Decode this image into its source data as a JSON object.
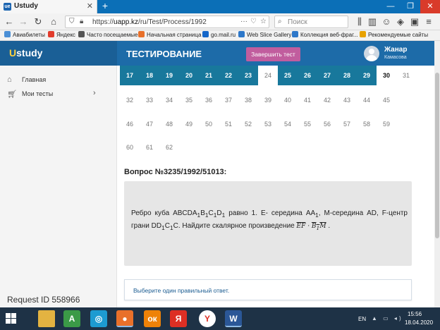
{
  "browser": {
    "tab_title": "Ustudy",
    "tab_favicon": "ue",
    "new_tab": "+",
    "url_prefix": "https://",
    "url_host": "uapp.kz",
    "url_path": "/ru/Test/Process/1992",
    "search_placeholder": "Поиск"
  },
  "bookmarks": [
    {
      "label": "Авиабилеты",
      "icon": "globe-icon",
      "color": "#4a8fd6"
    },
    {
      "label": "Яндекс",
      "icon": "yandex-icon",
      "color": "#e23c2c"
    },
    {
      "label": "Часто посещаемые",
      "icon": "gear-icon",
      "color": "#555555"
    },
    {
      "label": "Начальная страница",
      "icon": "firefox-icon",
      "color": "#e8702a"
    },
    {
      "label": "go.mail.ru",
      "icon": "mail-icon",
      "color": "#1466c9"
    },
    {
      "label": "Web Slice Gallery",
      "icon": "ie-icon",
      "color": "#2d77c9"
    },
    {
      "label": "Коллекция веб-фраг...",
      "icon": "ie-icon",
      "color": "#2d77c9"
    },
    {
      "label": "Рекомендуемые сайты",
      "icon": "ie-icon",
      "color": "#e8a200"
    }
  ],
  "header": {
    "brand_first": "U",
    "brand_rest": "study",
    "title": "ТЕСТИРОВАНИЕ",
    "finish_button": "Завершить тест",
    "user_name": "Жанар",
    "user_surname": "Камасова"
  },
  "sidebar": {
    "items": [
      {
        "label": "Главная",
        "icon": "home-icon"
      },
      {
        "label": "Мои тесты",
        "icon": "cart-icon",
        "chevron": "›"
      }
    ],
    "request_id": "Request ID 558966"
  },
  "question_grid": {
    "rows": [
      [
        "17",
        "18",
        "19",
        "20",
        "21",
        "22",
        "23",
        "24",
        "25",
        "26",
        "27",
        "28",
        "29",
        "30",
        "31"
      ],
      [
        "32",
        "33",
        "34",
        "35",
        "36",
        "37",
        "38",
        "39",
        "40",
        "41",
        "42",
        "43",
        "44",
        "45"
      ],
      [
        "46",
        "47",
        "48",
        "49",
        "50",
        "51",
        "52",
        "53",
        "54",
        "55",
        "56",
        "57",
        "58",
        "59"
      ],
      [
        "60",
        "61",
        "62"
      ]
    ],
    "answered": [
      "17",
      "18",
      "19",
      "20",
      "21",
      "22",
      "23",
      "25",
      "26",
      "27",
      "28",
      "29"
    ],
    "current": "30",
    "colors": {
      "answered": "#18789c",
      "pending": "#777777"
    }
  },
  "question": {
    "title": "Вопрос №3235/1992/51013:",
    "text_part1": "Ребро куба ABCDA",
    "text_part2": "B",
    "text_part3": "C",
    "text_part4": "D",
    "text_part5": " равно 1. E- середина AA",
    "text_part6": ", M-середина AD, F-центр грани DD",
    "text_part7": "C",
    "text_part8": "C. Найдите скалярное произведение ",
    "sub1": "1",
    "formula_a": "EF",
    "formula_dot": " · ",
    "formula_b": "B",
    "formula_b_sub": "1",
    "formula_c": "M",
    "formula_end": " ."
  },
  "answer_hint": "Выберите один правильный ответ.",
  "taskbar": {
    "lang": "EN",
    "time": "15:56",
    "date": "18.04.2020",
    "apps": [
      {
        "name": "file-explorer-icon",
        "glyph": "",
        "color": "#e3b341"
      },
      {
        "name": "android-studio-icon",
        "glyph": "A",
        "color": "#3b9a47"
      },
      {
        "name": "chrome-like-icon",
        "glyph": "◎",
        "color": "#1d9bd1"
      },
      {
        "name": "firefox-icon",
        "glyph": "●",
        "color": "#e8702a"
      },
      {
        "name": "odnoklassniki-icon",
        "glyph": "ок",
        "color": "#ee8208"
      },
      {
        "name": "yandex-browser-icon",
        "glyph": "Я",
        "color": "#dd2f24"
      },
      {
        "name": "yandex-icon",
        "glyph": "Y",
        "color": "#ffffff"
      },
      {
        "name": "word-icon",
        "glyph": "W",
        "color": "#2b5797"
      }
    ]
  }
}
